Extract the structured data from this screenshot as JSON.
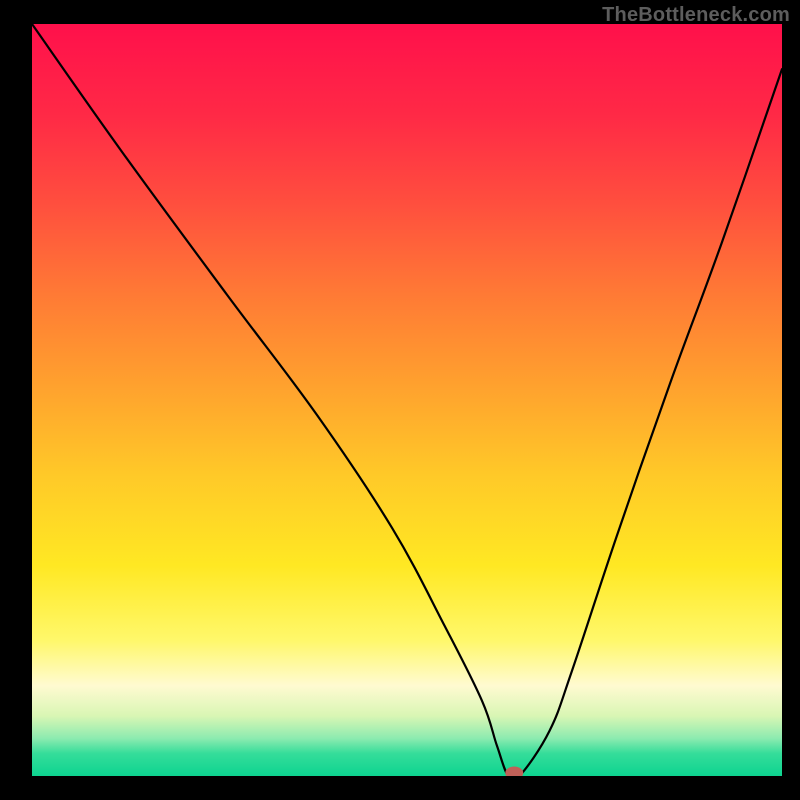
{
  "watermark": "TheBottleneck.com",
  "chart_data": {
    "type": "line",
    "title": "",
    "xlabel": "",
    "ylabel": "",
    "xlim": [
      0,
      100
    ],
    "ylim": [
      0,
      100
    ],
    "grid": false,
    "series": [
      {
        "name": "curve",
        "x": [
          0,
          12,
          26,
          38,
          48,
          55,
          60,
          62,
          63.5,
          65,
          69,
          72,
          78,
          85,
          92,
          100
        ],
        "values": [
          100,
          83,
          64,
          48,
          33,
          20,
          10,
          4,
          0,
          0,
          6,
          14,
          32,
          52,
          71,
          94
        ]
      }
    ],
    "marker": {
      "x": 64.3,
      "y": 0
    },
    "gradient_stops": [
      {
        "offset": 0,
        "color": "#ff104b"
      },
      {
        "offset": 12,
        "color": "#ff2946"
      },
      {
        "offset": 24,
        "color": "#ff4f3e"
      },
      {
        "offset": 36,
        "color": "#ff7a35"
      },
      {
        "offset": 48,
        "color": "#ffa12e"
      },
      {
        "offset": 60,
        "color": "#ffc928"
      },
      {
        "offset": 72,
        "color": "#ffe823"
      },
      {
        "offset": 82,
        "color": "#fff86b"
      },
      {
        "offset": 88,
        "color": "#fffad1"
      },
      {
        "offset": 92,
        "color": "#d9f6b4"
      },
      {
        "offset": 95,
        "color": "#8cebb0"
      },
      {
        "offset": 97,
        "color": "#35dd9a"
      },
      {
        "offset": 100,
        "color": "#0dd490"
      }
    ]
  }
}
